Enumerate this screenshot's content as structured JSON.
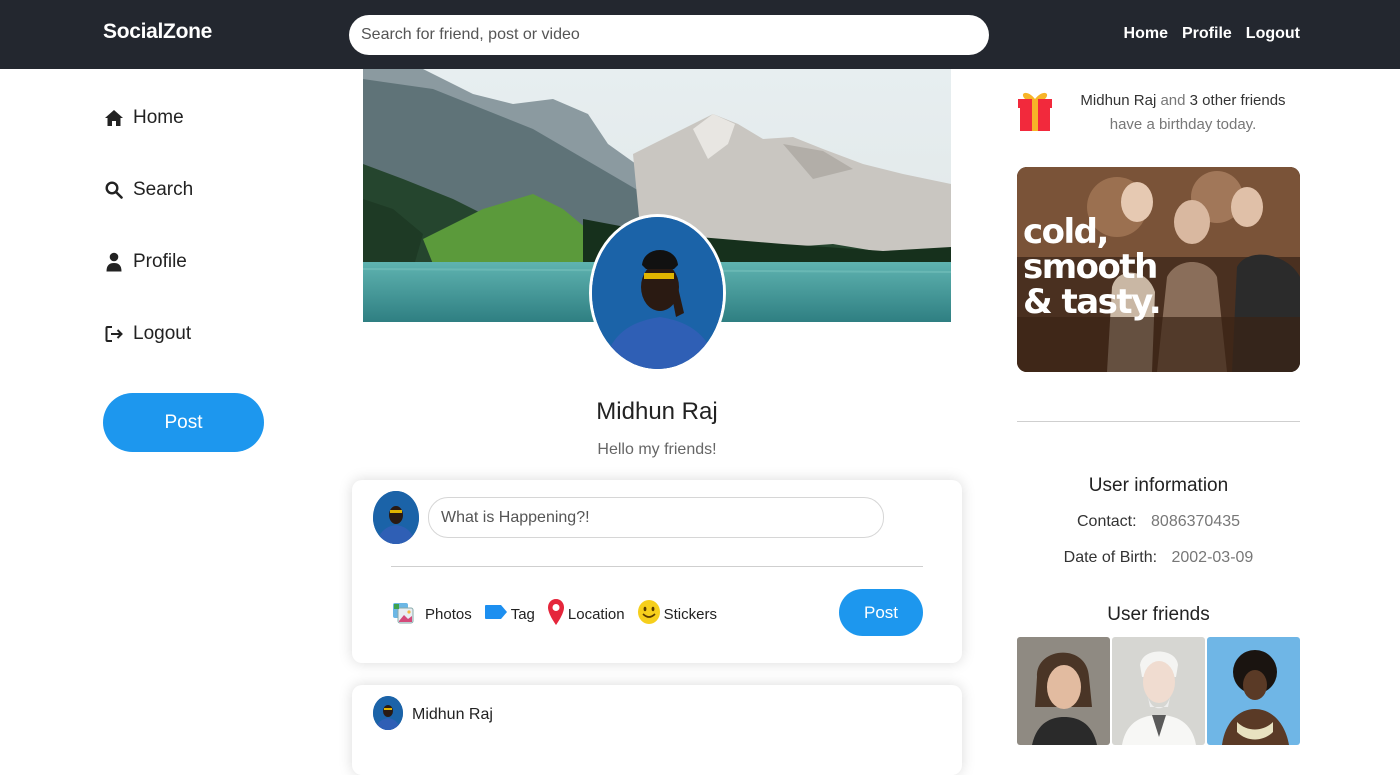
{
  "app": {
    "logo": "SocialZone"
  },
  "search": {
    "placeholder": "Search for friend, post or video"
  },
  "topnav": {
    "home": "Home",
    "profile": "Profile",
    "logout": "Logout"
  },
  "sidebar": {
    "items": [
      {
        "label": "Home",
        "icon": "home-icon"
      },
      {
        "label": "Search",
        "icon": "search-icon"
      },
      {
        "label": "Profile",
        "icon": "user-icon"
      },
      {
        "label": "Logout",
        "icon": "logout-icon"
      }
    ],
    "post_button": "Post"
  },
  "profile": {
    "name": "Midhun Raj",
    "bio": "Hello my friends!"
  },
  "composer": {
    "placeholder": "What is Happening?!",
    "options": [
      {
        "label": "Photos",
        "icon": "photos-icon"
      },
      {
        "label": "Tag",
        "icon": "tag-icon"
      },
      {
        "label": "Location",
        "icon": "location-pin-icon"
      },
      {
        "label": "Stickers",
        "icon": "smiley-icon"
      }
    ],
    "post_button": "Post"
  },
  "feed": {
    "author": "Midhun Raj"
  },
  "birthday": {
    "name": "Midhun Raj",
    "connector": "and",
    "others": "3 other friends",
    "rest": "have a birthday today."
  },
  "ad": {
    "line1": "cold,",
    "line2": "smooth",
    "line3": "& tasty."
  },
  "user_info": {
    "title": "User information",
    "contact_label": "Contact:",
    "contact_value": "8086370435",
    "dob_label": "Date of Birth:",
    "dob_value": "2002-03-09"
  },
  "friends": {
    "title": "User friends"
  },
  "colors": {
    "topbar": "#23272f",
    "accent": "#1d97ee"
  }
}
